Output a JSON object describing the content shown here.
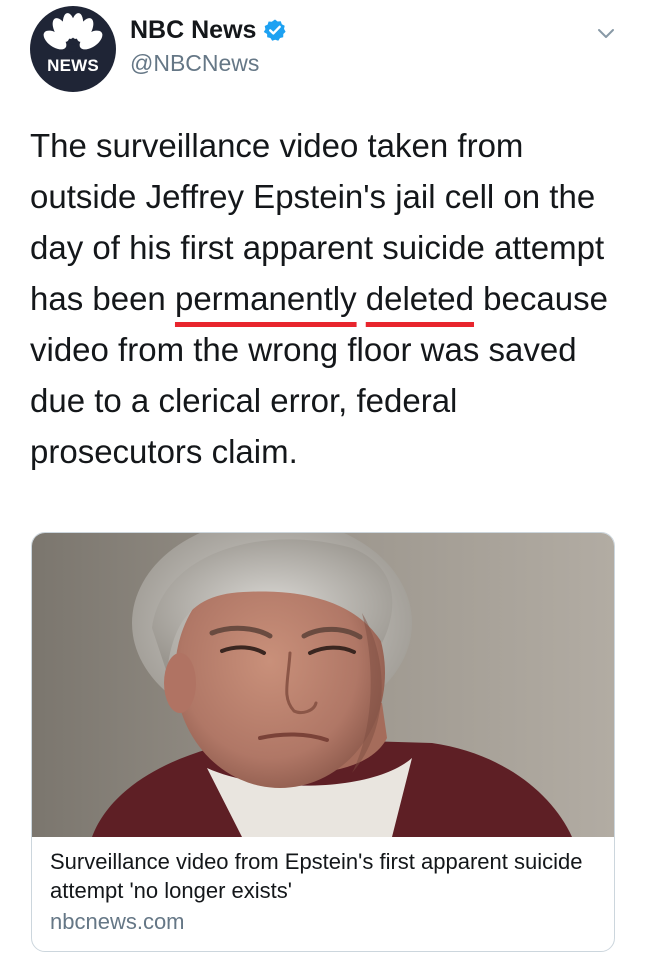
{
  "account": {
    "display_name": "NBC News",
    "handle": "@NBCNews",
    "avatar_text": "NEWS",
    "verified": true
  },
  "tweet": {
    "text_before": "The surveillance video taken from outside Jeffrey Epstein's jail cell on the day of his first apparent suicide attempt has been ",
    "highlight_1": "permanently",
    "text_between": " ",
    "highlight_2": "deleted",
    "text_after": " because video from the wrong floor was saved due to a clerical error, federal prosecutors claim.",
    "highlight_color": "#e8252d"
  },
  "card": {
    "title": "Surveillance video from Epstein's first apparent suicide attempt 'no longer exists'",
    "domain": "nbcnews.com",
    "image_alt": "photo-of-jeffrey-epstein"
  },
  "icons": {
    "verified": "verified-badge-icon",
    "menu": "chevron-down-icon",
    "logo": "nbc-peacock-logo-icon"
  },
  "colors": {
    "avatar_bg": "#1f2536",
    "verified_blue": "#1da1f2",
    "secondary_text": "#657786"
  }
}
